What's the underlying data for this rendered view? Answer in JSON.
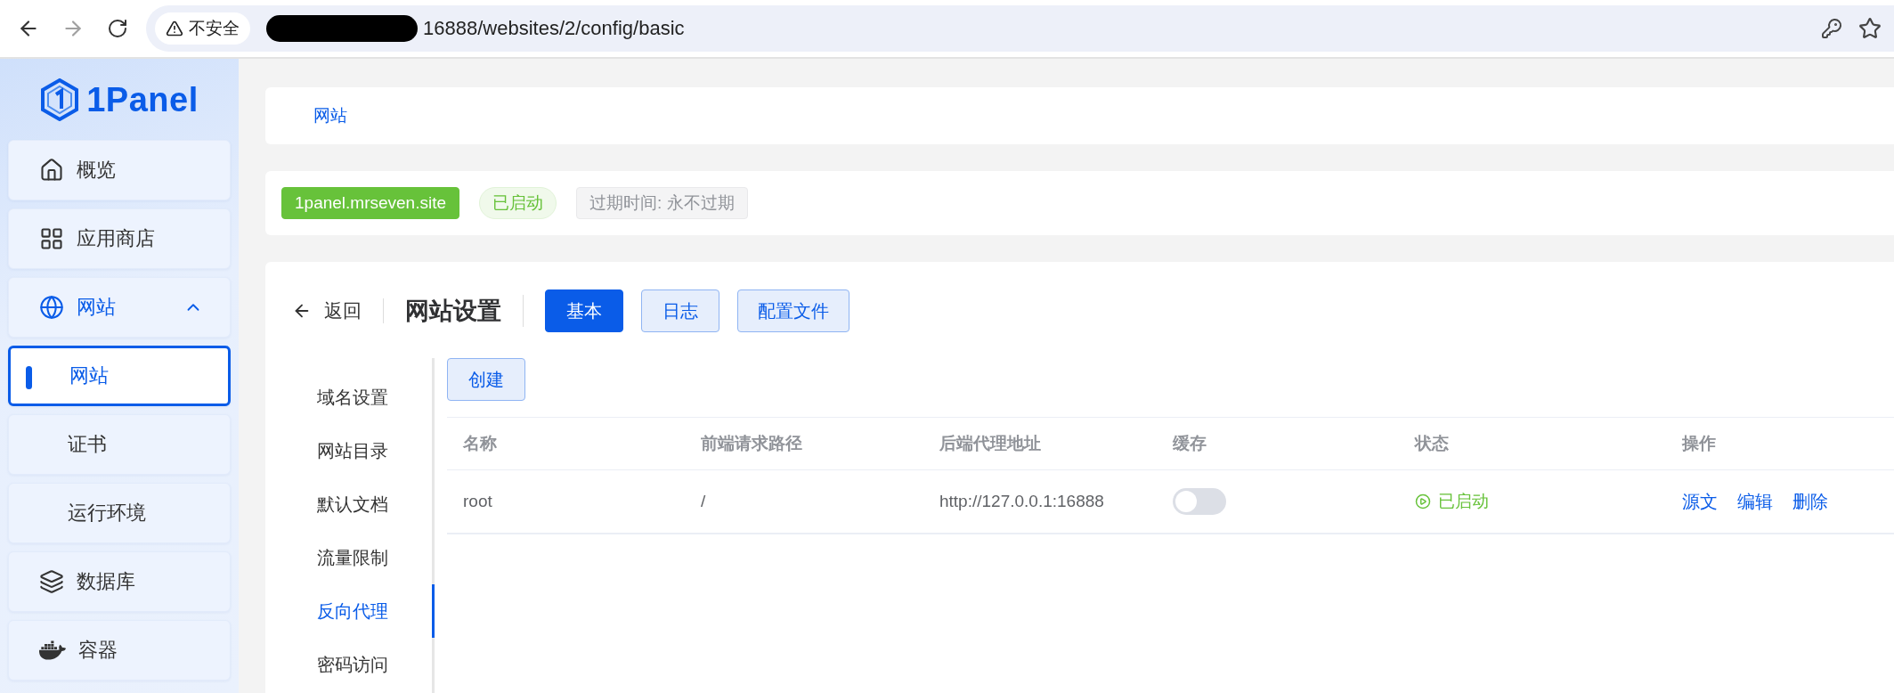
{
  "browser": {
    "security_label": "不安全",
    "url": "16888/websites/2/config/basic"
  },
  "sidebar": {
    "logo": "1Panel",
    "items": [
      {
        "label": "概览",
        "selected": false
      },
      {
        "label": "应用商店",
        "selected": false
      },
      {
        "label": "网站",
        "expanded": true,
        "selected": false,
        "children": [
          {
            "label": "网站",
            "selected": true
          },
          {
            "label": "证书",
            "selected": false
          },
          {
            "label": "运行环境",
            "selected": false
          }
        ]
      },
      {
        "label": "数据库",
        "selected": false
      },
      {
        "label": "容器",
        "selected": false
      }
    ]
  },
  "breadcrumb": "网站",
  "site": {
    "domain": "1panel.mrseven.site",
    "status": "已启动",
    "expiry": "过期时间: 永不过期"
  },
  "settings": {
    "back": "返回",
    "title": "网站设置",
    "tabs": [
      {
        "label": "基本",
        "selected": true
      },
      {
        "label": "日志",
        "selected": false
      },
      {
        "label": "配置文件",
        "selected": false
      }
    ],
    "menu": [
      {
        "label": "域名设置",
        "selected": false
      },
      {
        "label": "网站目录",
        "selected": false
      },
      {
        "label": "默认文档",
        "selected": false
      },
      {
        "label": "流量限制",
        "selected": false
      },
      {
        "label": "反向代理",
        "selected": true
      },
      {
        "label": "密码访问",
        "selected": false
      }
    ],
    "create_button": "创建",
    "table": {
      "columns": [
        "名称",
        "前端请求路径",
        "后端代理地址",
        "缓存",
        "状态",
        "操作"
      ],
      "rows": [
        {
          "name": "root",
          "path": "/",
          "backend": "http://127.0.0.1:16888",
          "cache": {
            "on": false
          },
          "status": "已启动",
          "actions": [
            "源文",
            "编辑",
            "删除"
          ]
        }
      ]
    }
  }
}
